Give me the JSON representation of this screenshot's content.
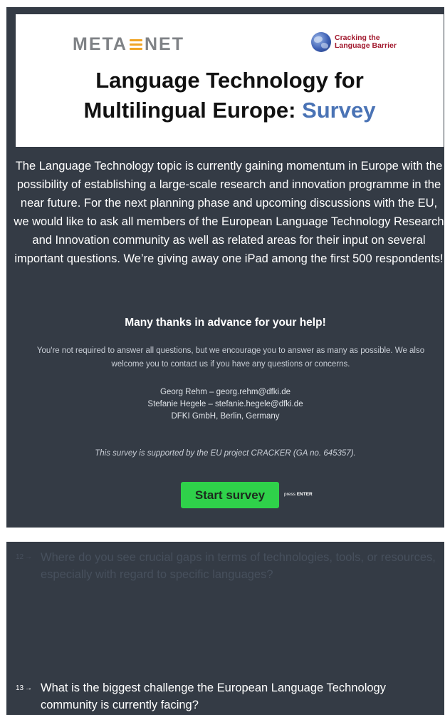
{
  "header": {
    "meta_left": "META",
    "meta_right": "NET",
    "cracker_line1": "Cracking the",
    "cracker_line2": "Language Barrier",
    "title_line1": "Language Technology for",
    "title_line2_plain": "Multilingual Europe: ",
    "title_line2_accent": "Survey"
  },
  "welcome": {
    "intro": "The Language Technology topic is currently gaining momentum in Europe with the possibility of establishing a large-scale research and innovation programme in the near future. For the next planning phase and upcoming discussions with the EU, we would like to ask all members of the European Language Technology Research and Innovation community as well as related areas for their input on several important questions. We’re giving away one iPad among the first 500 respondents!",
    "thanks": "Many thanks in advance for your help!",
    "note": "You're not required to answer all questions, but we encourage you to answer as many as possible. We also welcome you to contact us if you have any questions or concerns.",
    "contacts": [
      "Georg Rehm – georg.rehm@dfki.de",
      "Stefanie Hegele – stefanie.hegele@dfki.de",
      "DFKI GmbH, Berlin, Germany"
    ],
    "support": "This survey is supported by the EU project CRACKER (GA no. 645357).",
    "start_button": "Start survey",
    "press_prefix": "press ",
    "press_key": "ENTER"
  },
  "questions": [
    {
      "number": "12",
      "arrow": "→",
      "text": "Where do you see crucial gaps in terms of technologies, tools, or resources, especially with regard to specific languages?"
    },
    {
      "number": "13",
      "arrow": "→",
      "text": "What is the biggest challenge the European Language Technology community is currently facing?"
    }
  ],
  "colors": {
    "panel_bg": "#343b45",
    "accent_blue": "#4a73b5",
    "start_green": "#2fd14a",
    "meta_orange": "#f0a424",
    "cracker_red": "#a2192e"
  }
}
